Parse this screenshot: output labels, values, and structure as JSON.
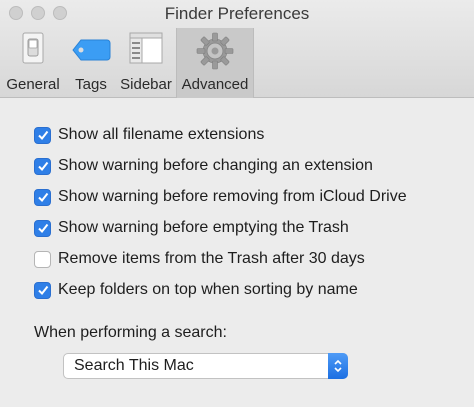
{
  "window": {
    "title": "Finder Preferences"
  },
  "tabs": [
    {
      "label": "General",
      "icon": "general-switch-icon"
    },
    {
      "label": "Tags",
      "icon": "tag-icon"
    },
    {
      "label": "Sidebar",
      "icon": "sidebar-icon"
    },
    {
      "label": "Advanced",
      "icon": "gear-icon",
      "selected": true
    }
  ],
  "options": [
    {
      "label": "Show all filename extensions",
      "checked": true
    },
    {
      "label": "Show warning before changing an extension",
      "checked": true
    },
    {
      "label": "Show warning before removing from iCloud Drive",
      "checked": true
    },
    {
      "label": "Show warning before emptying the Trash",
      "checked": true
    },
    {
      "label": "Remove items from the Trash after 30 days",
      "checked": false
    },
    {
      "label": "Keep folders on top when sorting by name",
      "checked": true
    }
  ],
  "search": {
    "label": "When performing a search:",
    "selected": "Search This Mac"
  },
  "colors": {
    "accent": "#2f7fe7",
    "background": "#ececec"
  }
}
